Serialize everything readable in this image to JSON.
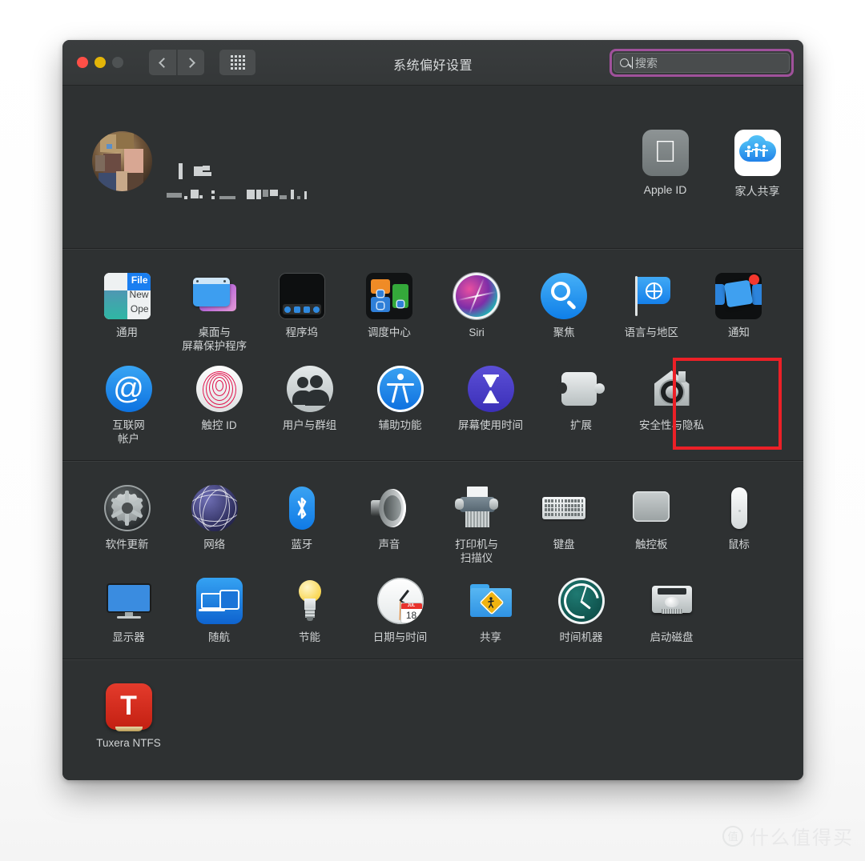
{
  "window": {
    "title": "系统偏好设置",
    "traffic": {
      "close": "close-button",
      "minimize": "minimize-button",
      "zoom": "zoom-button"
    },
    "nav": {
      "back": "‹",
      "forward": "›"
    },
    "search": {
      "placeholder": "搜索",
      "value": "",
      "focus_color": "#a0519b"
    }
  },
  "account": {
    "name_redacted": true,
    "email_redacted": true,
    "apple_id": {
      "label": "Apple ID",
      "icon": "apple-logo-icon"
    },
    "family_sharing": {
      "label": "家人共享",
      "icon": "family-sharing-icon"
    }
  },
  "sections": [
    {
      "name": "personal",
      "rows": [
        [
          {
            "label": "通用",
            "icon": "general-icon"
          },
          {
            "label": "桌面与\n屏幕保护程序",
            "icon": "desktop-screensaver-icon"
          },
          {
            "label": "程序坞",
            "icon": "dock-icon"
          },
          {
            "label": "调度中心",
            "icon": "mission-control-icon"
          },
          {
            "label": "Siri",
            "icon": "siri-icon"
          },
          {
            "label": "聚焦",
            "icon": "spotlight-icon"
          },
          {
            "label": "语言与地区",
            "icon": "language-region-icon"
          },
          {
            "label": "通知",
            "icon": "notifications-icon"
          }
        ],
        [
          {
            "label": "互联网\n帐户",
            "icon": "internet-accounts-icon"
          },
          {
            "label": "触控 ID",
            "icon": "touch-id-icon"
          },
          {
            "label": "用户与群组",
            "icon": "users-groups-icon"
          },
          {
            "label": "辅助功能",
            "icon": "accessibility-icon"
          },
          {
            "label": "屏幕使用时间",
            "icon": "screen-time-icon"
          },
          {
            "label": "扩展",
            "icon": "extensions-icon"
          },
          {
            "label": "安全性与隐私",
            "icon": "security-privacy-icon",
            "highlighted": true
          }
        ]
      ]
    },
    {
      "name": "hardware",
      "rows": [
        [
          {
            "label": "软件更新",
            "icon": "software-update-icon"
          },
          {
            "label": "网络",
            "icon": "network-icon"
          },
          {
            "label": "蓝牙",
            "icon": "bluetooth-icon"
          },
          {
            "label": "声音",
            "icon": "sound-icon"
          },
          {
            "label": "打印机与\n扫描仪",
            "icon": "printers-scanners-icon"
          },
          {
            "label": "键盘",
            "icon": "keyboard-icon"
          },
          {
            "label": "触控板",
            "icon": "trackpad-icon"
          },
          {
            "label": "鼠标",
            "icon": "mouse-icon"
          }
        ],
        [
          {
            "label": "显示器",
            "icon": "displays-icon"
          },
          {
            "label": "随航",
            "icon": "sidecar-icon"
          },
          {
            "label": "节能",
            "icon": "energy-saver-icon"
          },
          {
            "label": "日期与时间",
            "icon": "date-time-icon",
            "calendar_month": "JUL",
            "calendar_day": "18"
          },
          {
            "label": "共享",
            "icon": "sharing-icon"
          },
          {
            "label": "时间机器",
            "icon": "time-machine-icon"
          },
          {
            "label": "启动磁盘",
            "icon": "startup-disk-icon"
          }
        ]
      ]
    },
    {
      "name": "third-party",
      "rows": [
        [
          {
            "label": "Tuxera NTFS",
            "icon": "tuxera-ntfs-icon",
            "glyph": "T"
          }
        ]
      ]
    }
  ],
  "highlight": {
    "color": "#ec2027",
    "target": "安全性与隐私"
  },
  "watermark": {
    "mark": "值",
    "text": "什么值得买"
  }
}
